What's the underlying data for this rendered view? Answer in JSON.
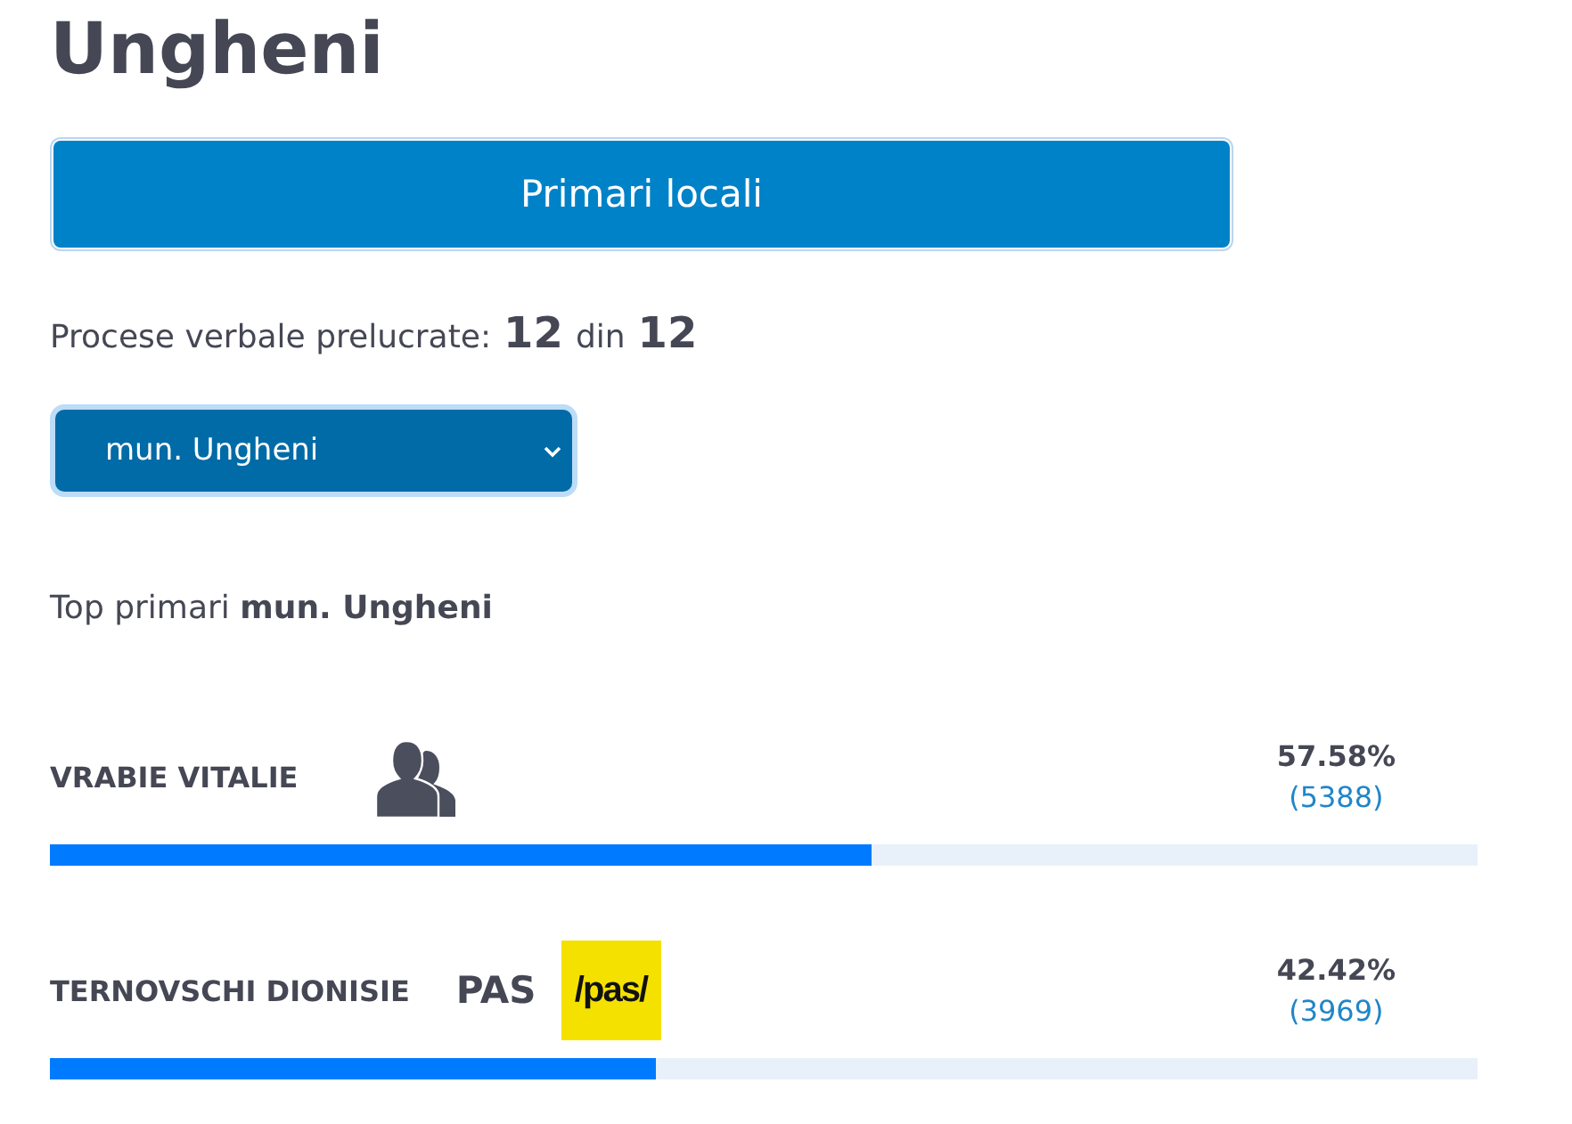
{
  "title": "Ungheni",
  "main_button": "Primari locali",
  "progress": {
    "label": "Procese verbale prelucrate:",
    "done": "12",
    "separator": "din",
    "total": "12"
  },
  "locality_select": {
    "value": "mun. Ungheni"
  },
  "top_heading": "Top primari **mun. Ungheni**",
  "candidates": [
    {
      "name": "VRABIE VITALIE",
      "kind": "independent",
      "percent": "57.58%",
      "votes": "(5388)",
      "level": 0.5758
    },
    {
      "name": "TERNOVSCHI DIONISIE",
      "kind": "party",
      "party": "PAS",
      "logo_text": "/pas/",
      "percent": "42.42%",
      "votes": "(3969)",
      "level": 0.4242
    }
  ]
}
